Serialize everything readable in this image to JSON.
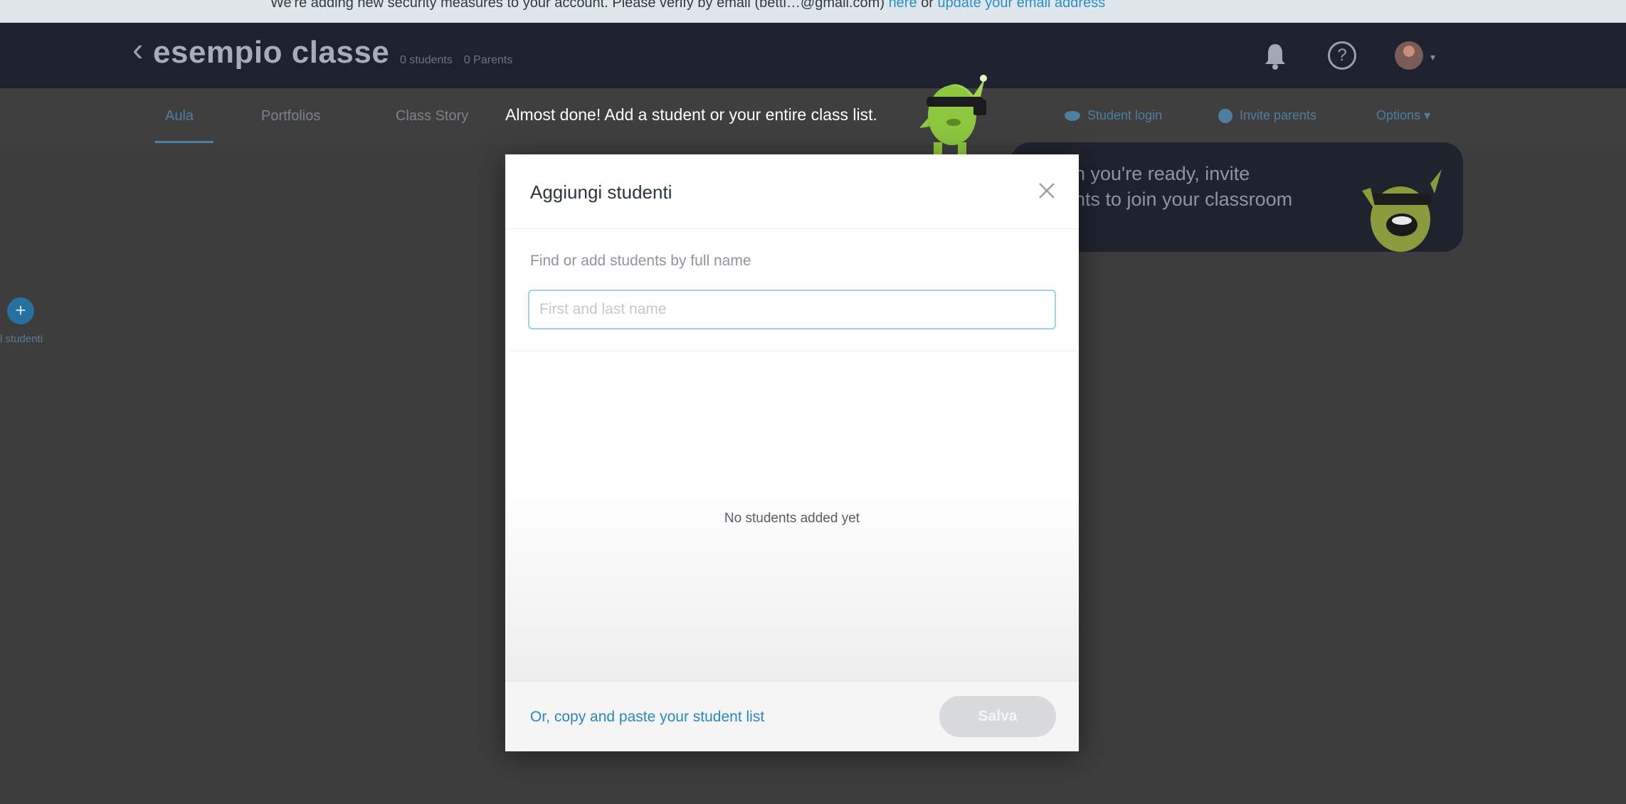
{
  "banner": {
    "text": "We're adding new security measures to your account. Please verify by email",
    "email": "(betti…@gmail.com)",
    "link_here": "here",
    "or": "or",
    "link_update": "update your email address"
  },
  "header": {
    "back_icon": "chevron-left-icon",
    "class_name": "esempio classe",
    "students_count": "0 students",
    "parents_count": "0 Parents",
    "icons": [
      "bell-icon",
      "help-icon",
      "avatar",
      "chevron-down-icon"
    ],
    "help_glyph": "?"
  },
  "nav": {
    "tabs": [
      {
        "label": "Aula"
      },
      {
        "label": "Portfolios"
      },
      {
        "label": "Class Story"
      }
    ],
    "student_login": "Student login",
    "invite_parents": "Invite parents",
    "options": "Options"
  },
  "onboarding": {
    "message": "Almost done! Add a student or your entire class list.",
    "tip_line1": "n you're ready, invite",
    "tip_line2": "nts to join your classroom"
  },
  "sidebar": {
    "add_label": "l studenti"
  },
  "modal": {
    "title": "Aggiungi studenti",
    "find_label": "Find or add students by full name",
    "input_placeholder": "First and last name",
    "input_value": "",
    "empty_message": "No students added yet",
    "paste_link": "Or, copy and paste your student list",
    "save_label": "Salva"
  },
  "colors": {
    "accent": "#2b86c2",
    "header_bg": "#1e2230",
    "overlay_bg": "#3d3d3d",
    "monster_green": "#8dc63f"
  }
}
